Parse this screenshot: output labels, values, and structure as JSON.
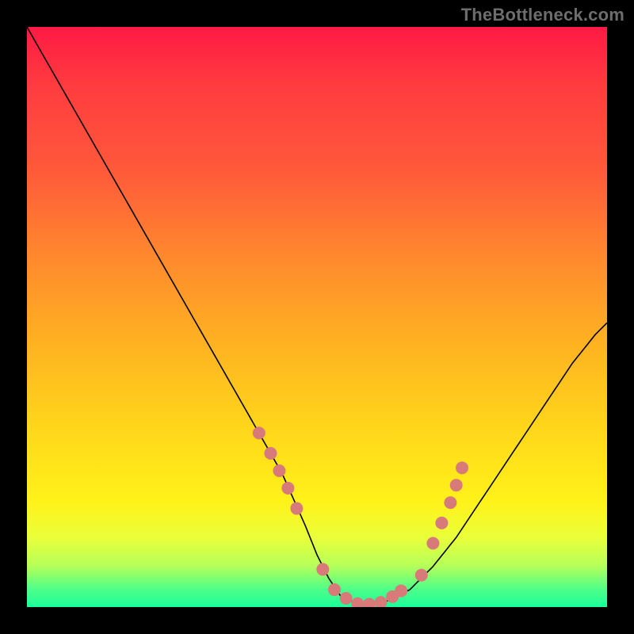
{
  "watermark": "TheBottleneck.com",
  "colors": {
    "curve": "#000000",
    "curve_width": 1.6,
    "marker_fill": "#d97a7a",
    "marker_radius": 8
  },
  "chart_data": {
    "type": "line",
    "title": "",
    "xlabel": "",
    "ylabel": "",
    "xlim": [
      0,
      100
    ],
    "ylim": [
      0,
      100
    ],
    "grid": false,
    "legend": false,
    "series": [
      {
        "name": "curve",
        "x": [
          0,
          4,
          8,
          12,
          16,
          20,
          24,
          28,
          32,
          36,
          40,
          44,
          48,
          50,
          52,
          54,
          56,
          58,
          60,
          62,
          66,
          70,
          74,
          78,
          82,
          86,
          90,
          94,
          98,
          100
        ],
        "y": [
          100,
          93,
          86,
          79,
          72,
          65,
          58,
          51,
          44,
          37,
          30,
          23,
          14,
          9,
          5,
          2,
          1,
          0.5,
          0.5,
          1,
          3,
          7,
          12,
          18,
          24,
          30,
          36,
          42,
          47,
          49
        ]
      }
    ],
    "markers": {
      "name": "highlighted-range",
      "points": [
        {
          "x": 40.0,
          "y": 30.0
        },
        {
          "x": 42.0,
          "y": 26.5
        },
        {
          "x": 43.5,
          "y": 23.5
        },
        {
          "x": 45.0,
          "y": 20.5
        },
        {
          "x": 46.5,
          "y": 17.0
        },
        {
          "x": 51.0,
          "y": 6.5
        },
        {
          "x": 53.0,
          "y": 3.0
        },
        {
          "x": 55.0,
          "y": 1.5
        },
        {
          "x": 57.0,
          "y": 0.6
        },
        {
          "x": 59.0,
          "y": 0.5
        },
        {
          "x": 61.0,
          "y": 0.8
        },
        {
          "x": 63.0,
          "y": 1.8
        },
        {
          "x": 64.5,
          "y": 2.8
        },
        {
          "x": 68.0,
          "y": 5.5
        },
        {
          "x": 70.0,
          "y": 11.0
        },
        {
          "x": 71.5,
          "y": 14.5
        },
        {
          "x": 73.0,
          "y": 18.0
        },
        {
          "x": 74.0,
          "y": 21.0
        },
        {
          "x": 75.0,
          "y": 24.0
        }
      ]
    }
  }
}
